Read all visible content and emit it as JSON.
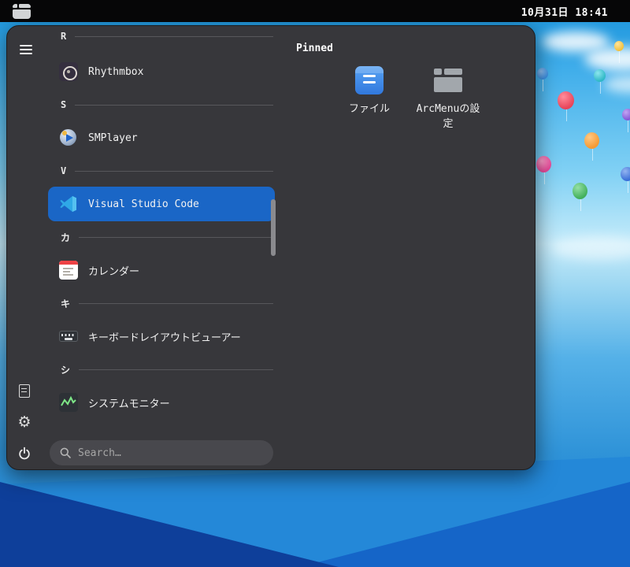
{
  "colors": {
    "accent": "#1a66c6",
    "menu_bg": "#37373b",
    "topbar_bg": "#060607"
  },
  "topbar": {
    "menu_button_icon": "arcmenu-logo-icon",
    "clock": "10月31日 18:41"
  },
  "menu": {
    "left_rail": {
      "items": [
        {
          "icon": "hamburger-menu-icon"
        },
        {
          "icon": "documents-icon"
        },
        {
          "icon": "settings-gear-icon"
        },
        {
          "icon": "power-icon"
        }
      ]
    },
    "groups": [
      {
        "letter": "R",
        "apps": [
          {
            "name": "Rhythmbox",
            "icon": "rhythmbox-icon"
          }
        ]
      },
      {
        "letter": "S",
        "apps": [
          {
            "name": "SMPlayer",
            "icon": "smplayer-icon"
          }
        ]
      },
      {
        "letter": "V",
        "apps": [
          {
            "name": "Visual Studio Code",
            "icon": "vscode-icon",
            "selected": true
          }
        ]
      },
      {
        "letter": "カ",
        "apps": [
          {
            "name": "カレンダー",
            "icon": "calendar-icon"
          }
        ]
      },
      {
        "letter": "キ",
        "apps": [
          {
            "name": "キーボードレイアウトビューアー",
            "icon": "keyboard-icon"
          }
        ]
      },
      {
        "letter": "シ",
        "apps": [
          {
            "name": "システムモニター",
            "icon": "system-monitor-icon"
          }
        ]
      }
    ],
    "selected_app": "Visual Studio Code",
    "search": {
      "placeholder": "Search…"
    },
    "pinned": {
      "title": "Pinned",
      "items": [
        {
          "label": "ファイル",
          "icon": "files-icon"
        },
        {
          "label": "ArcMenuの設定",
          "icon": "arcmenu-logo-icon"
        }
      ]
    }
  }
}
